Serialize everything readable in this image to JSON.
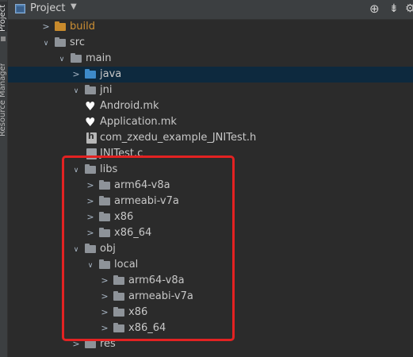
{
  "sidebar": {
    "project_tab": "Project",
    "resource_tab": "Resource Manager"
  },
  "header": {
    "title": "Project",
    "caret": "▼",
    "icons": [
      "locate-icon",
      "collapse-icon"
    ]
  },
  "tree": [
    {
      "label": "build",
      "folder": "orange",
      "expand": "collapsed",
      "depth": 0,
      "style": "orange"
    },
    {
      "label": "src",
      "folder": "grey",
      "expand": "expanded",
      "depth": 0
    },
    {
      "label": "main",
      "folder": "grey",
      "expand": "expanded",
      "depth": 1
    },
    {
      "label": "java",
      "folder": "blue",
      "expand": "collapsed",
      "depth": 2,
      "selected": true
    },
    {
      "label": "jni",
      "folder": "grey",
      "expand": "expanded",
      "depth": 2
    },
    {
      "label": "Android.mk",
      "file": "mk",
      "depth": 3
    },
    {
      "label": "Application.mk",
      "file": "mk",
      "depth": 3
    },
    {
      "label": "com_zxedu_example_JNITest.h",
      "file": "h",
      "depth": 3
    },
    {
      "label": "JNITest.c",
      "file": "c",
      "depth": 3
    },
    {
      "label": "libs",
      "folder": "grey",
      "expand": "expanded",
      "depth": 2
    },
    {
      "label": "arm64-v8a",
      "folder": "grey",
      "expand": "collapsed",
      "depth": 3
    },
    {
      "label": "armeabi-v7a",
      "folder": "grey",
      "expand": "collapsed",
      "depth": 3
    },
    {
      "label": "x86",
      "folder": "grey",
      "expand": "collapsed",
      "depth": 3
    },
    {
      "label": "x86_64",
      "folder": "grey",
      "expand": "collapsed",
      "depth": 3
    },
    {
      "label": "obj",
      "folder": "grey",
      "expand": "expanded",
      "depth": 2
    },
    {
      "label": "local",
      "folder": "grey",
      "expand": "expanded",
      "depth": 3
    },
    {
      "label": "arm64-v8a",
      "folder": "grey",
      "expand": "collapsed",
      "depth": 4
    },
    {
      "label": "armeabi-v7a",
      "folder": "grey",
      "expand": "collapsed",
      "depth": 4
    },
    {
      "label": "x86",
      "folder": "grey",
      "expand": "collapsed",
      "depth": 4
    },
    {
      "label": "x86_64",
      "folder": "grey",
      "expand": "collapsed",
      "depth": 4
    },
    {
      "label": "res",
      "folder": "grey",
      "expand": "collapsed",
      "depth": 2
    }
  ],
  "colors": {
    "highlight_box": "#e32222",
    "selection": "#0d293e"
  }
}
